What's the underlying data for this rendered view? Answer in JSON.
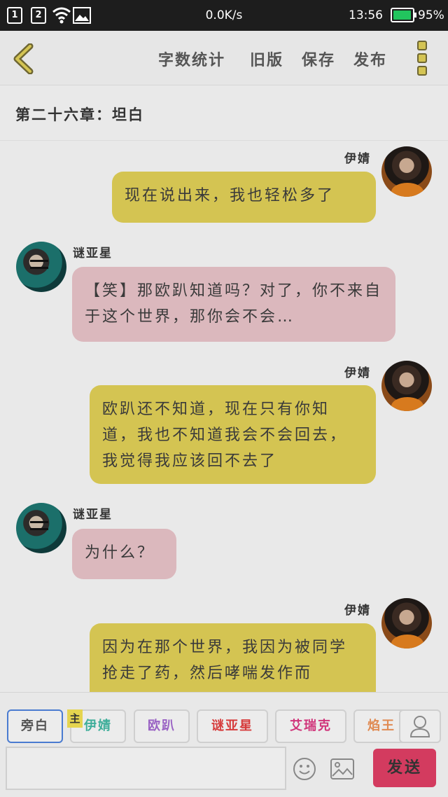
{
  "status_bar": {
    "sim1": "1",
    "sim2": "2",
    "network_speed": "0.0K/s",
    "time": "13:56",
    "battery_percent": "95%",
    "battery_level": 0.95,
    "battery_color": "#22c55e"
  },
  "toolbar": {
    "word_count": "字数统计",
    "old_version": "旧版",
    "save": "保存",
    "publish": "发布"
  },
  "chapter_title": "第二十六章：坦白",
  "messages": [
    {
      "speaker": "伊婧",
      "side": "right",
      "text": "现在说出来，我也轻松多了"
    },
    {
      "speaker": "谜亚星",
      "side": "left",
      "text": "【笑】那欧趴知道吗？对了，你不来自于这个世界，那你会不会…"
    },
    {
      "speaker": "伊婧",
      "side": "right",
      "text": "欧趴还不知道，现在只有你知道，我也不知道我会不会回去，我觉得我应该回不去了"
    },
    {
      "speaker": "谜亚星",
      "side": "left",
      "text": "为什么？"
    },
    {
      "speaker": "伊婧",
      "side": "right",
      "text": "因为在那个世界，我因为被同学抢走了药，然后哮喘发作而"
    }
  ],
  "role_bar": {
    "main_badge": "主",
    "roles": [
      {
        "label": "旁白",
        "color": "#555555"
      },
      {
        "label": "伊婧",
        "color": "#3fae9a"
      },
      {
        "label": "欧趴",
        "color": "#9a63c4"
      },
      {
        "label": "谜亚星",
        "color": "#d63a3a"
      },
      {
        "label": "艾瑞克",
        "color": "#d0347a"
      },
      {
        "label": "焰王",
        "color": "#e08a52"
      }
    ]
  },
  "composer": {
    "input_value": "",
    "send_label": "发送",
    "send_color": "#d33b5f"
  },
  "colors": {
    "bubble_right": "#d4c452",
    "bubble_left": "#dbb8bd"
  }
}
